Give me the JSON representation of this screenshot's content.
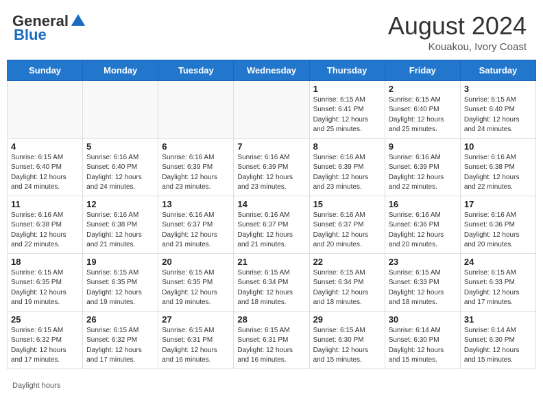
{
  "header": {
    "logo_general": "General",
    "logo_blue": "Blue",
    "month_year": "August 2024",
    "location": "Kouakou, Ivory Coast"
  },
  "weekdays": [
    "Sunday",
    "Monday",
    "Tuesday",
    "Wednesday",
    "Thursday",
    "Friday",
    "Saturday"
  ],
  "weeks": [
    [
      {
        "day": "",
        "info": ""
      },
      {
        "day": "",
        "info": ""
      },
      {
        "day": "",
        "info": ""
      },
      {
        "day": "",
        "info": ""
      },
      {
        "day": "1",
        "info": "Sunrise: 6:15 AM\nSunset: 6:41 PM\nDaylight: 12 hours\nand 25 minutes."
      },
      {
        "day": "2",
        "info": "Sunrise: 6:15 AM\nSunset: 6:40 PM\nDaylight: 12 hours\nand 25 minutes."
      },
      {
        "day": "3",
        "info": "Sunrise: 6:15 AM\nSunset: 6:40 PM\nDaylight: 12 hours\nand 24 minutes."
      }
    ],
    [
      {
        "day": "4",
        "info": "Sunrise: 6:15 AM\nSunset: 6:40 PM\nDaylight: 12 hours\nand 24 minutes."
      },
      {
        "day": "5",
        "info": "Sunrise: 6:16 AM\nSunset: 6:40 PM\nDaylight: 12 hours\nand 24 minutes."
      },
      {
        "day": "6",
        "info": "Sunrise: 6:16 AM\nSunset: 6:39 PM\nDaylight: 12 hours\nand 23 minutes."
      },
      {
        "day": "7",
        "info": "Sunrise: 6:16 AM\nSunset: 6:39 PM\nDaylight: 12 hours\nand 23 minutes."
      },
      {
        "day": "8",
        "info": "Sunrise: 6:16 AM\nSunset: 6:39 PM\nDaylight: 12 hours\nand 23 minutes."
      },
      {
        "day": "9",
        "info": "Sunrise: 6:16 AM\nSunset: 6:39 PM\nDaylight: 12 hours\nand 22 minutes."
      },
      {
        "day": "10",
        "info": "Sunrise: 6:16 AM\nSunset: 6:38 PM\nDaylight: 12 hours\nand 22 minutes."
      }
    ],
    [
      {
        "day": "11",
        "info": "Sunrise: 6:16 AM\nSunset: 6:38 PM\nDaylight: 12 hours\nand 22 minutes."
      },
      {
        "day": "12",
        "info": "Sunrise: 6:16 AM\nSunset: 6:38 PM\nDaylight: 12 hours\nand 21 minutes."
      },
      {
        "day": "13",
        "info": "Sunrise: 6:16 AM\nSunset: 6:37 PM\nDaylight: 12 hours\nand 21 minutes."
      },
      {
        "day": "14",
        "info": "Sunrise: 6:16 AM\nSunset: 6:37 PM\nDaylight: 12 hours\nand 21 minutes."
      },
      {
        "day": "15",
        "info": "Sunrise: 6:16 AM\nSunset: 6:37 PM\nDaylight: 12 hours\nand 20 minutes."
      },
      {
        "day": "16",
        "info": "Sunrise: 6:16 AM\nSunset: 6:36 PM\nDaylight: 12 hours\nand 20 minutes."
      },
      {
        "day": "17",
        "info": "Sunrise: 6:16 AM\nSunset: 6:36 PM\nDaylight: 12 hours\nand 20 minutes."
      }
    ],
    [
      {
        "day": "18",
        "info": "Sunrise: 6:15 AM\nSunset: 6:35 PM\nDaylight: 12 hours\nand 19 minutes."
      },
      {
        "day": "19",
        "info": "Sunrise: 6:15 AM\nSunset: 6:35 PM\nDaylight: 12 hours\nand 19 minutes."
      },
      {
        "day": "20",
        "info": "Sunrise: 6:15 AM\nSunset: 6:35 PM\nDaylight: 12 hours\nand 19 minutes."
      },
      {
        "day": "21",
        "info": "Sunrise: 6:15 AM\nSunset: 6:34 PM\nDaylight: 12 hours\nand 18 minutes."
      },
      {
        "day": "22",
        "info": "Sunrise: 6:15 AM\nSunset: 6:34 PM\nDaylight: 12 hours\nand 18 minutes."
      },
      {
        "day": "23",
        "info": "Sunrise: 6:15 AM\nSunset: 6:33 PM\nDaylight: 12 hours\nand 18 minutes."
      },
      {
        "day": "24",
        "info": "Sunrise: 6:15 AM\nSunset: 6:33 PM\nDaylight: 12 hours\nand 17 minutes."
      }
    ],
    [
      {
        "day": "25",
        "info": "Sunrise: 6:15 AM\nSunset: 6:32 PM\nDaylight: 12 hours\nand 17 minutes."
      },
      {
        "day": "26",
        "info": "Sunrise: 6:15 AM\nSunset: 6:32 PM\nDaylight: 12 hours\nand 17 minutes."
      },
      {
        "day": "27",
        "info": "Sunrise: 6:15 AM\nSunset: 6:31 PM\nDaylight: 12 hours\nand 16 minutes."
      },
      {
        "day": "28",
        "info": "Sunrise: 6:15 AM\nSunset: 6:31 PM\nDaylight: 12 hours\nand 16 minutes."
      },
      {
        "day": "29",
        "info": "Sunrise: 6:15 AM\nSunset: 6:30 PM\nDaylight: 12 hours\nand 15 minutes."
      },
      {
        "day": "30",
        "info": "Sunrise: 6:14 AM\nSunset: 6:30 PM\nDaylight: 12 hours\nand 15 minutes."
      },
      {
        "day": "31",
        "info": "Sunrise: 6:14 AM\nSunset: 6:30 PM\nDaylight: 12 hours\nand 15 minutes."
      }
    ]
  ],
  "footer": {
    "daylight_hours": "Daylight hours"
  }
}
